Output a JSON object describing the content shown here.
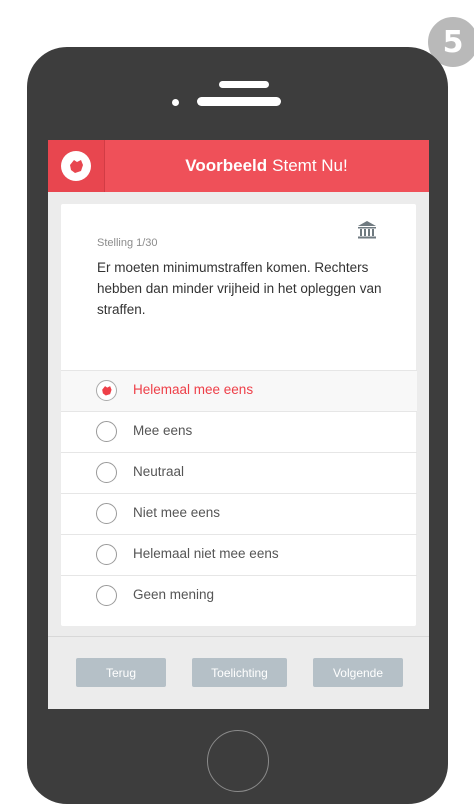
{
  "step_badge": "5",
  "header": {
    "title_bold": "Voorbeeld",
    "title_rest": "Stemt Nu!",
    "logo_icon": "party-logo-icon"
  },
  "statement": {
    "counter": "Stelling 1/30",
    "text": "Er moeten minimumstraffen komen. Rechters hebben dan minder vrijheid in het opleggen van straffen.",
    "info_icon": "museum-icon"
  },
  "options": [
    {
      "label": "Helemaal mee eens",
      "selected": true
    },
    {
      "label": "Mee eens",
      "selected": false
    },
    {
      "label": "Neutraal",
      "selected": false
    },
    {
      "label": "Niet mee eens",
      "selected": false
    },
    {
      "label": "Helemaal niet mee eens",
      "selected": false
    },
    {
      "label": "Geen mening",
      "selected": false
    }
  ],
  "buttons": {
    "back": "Terug",
    "explain": "Toelichting",
    "next": "Volgende"
  },
  "colors": {
    "accent": "#ef5059",
    "button": "#b5c0c7",
    "phone_body": "#3d3d3d"
  }
}
